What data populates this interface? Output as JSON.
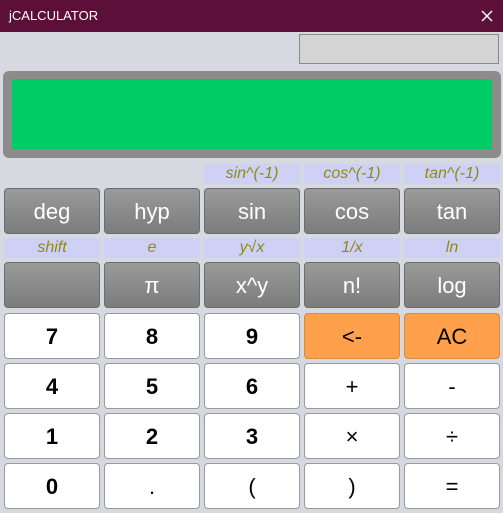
{
  "window": {
    "title": "jCALCULATOR"
  },
  "display": {
    "value": ""
  },
  "labels": {
    "row1": [
      "sin^(-1)",
      "cos^(-1)",
      "tan^(-1)"
    ],
    "row2": [
      "shift",
      "e",
      "y√x",
      "1/x",
      "ln"
    ]
  },
  "buttons": {
    "row1": [
      "deg",
      "hyp",
      "sin",
      "cos",
      "tan"
    ],
    "row2": [
      "",
      "π",
      "x^y",
      "n!",
      "log"
    ],
    "row3": [
      "7",
      "8",
      "9",
      "<-",
      "AC"
    ],
    "row4": [
      "4",
      "5",
      "6",
      "+",
      "-"
    ],
    "row5": [
      "1",
      "2",
      "3",
      "×",
      "÷"
    ],
    "row6": [
      "0",
      ".",
      "(",
      ")",
      "="
    ]
  },
  "colors": {
    "titlebar": "#5c1039",
    "display": "#00cc66",
    "accent_orange": "#ffa04c",
    "label_text": "#8c8c14",
    "label_bg": "#cfd0f5"
  },
  "icons": {
    "close": "close-icon"
  }
}
